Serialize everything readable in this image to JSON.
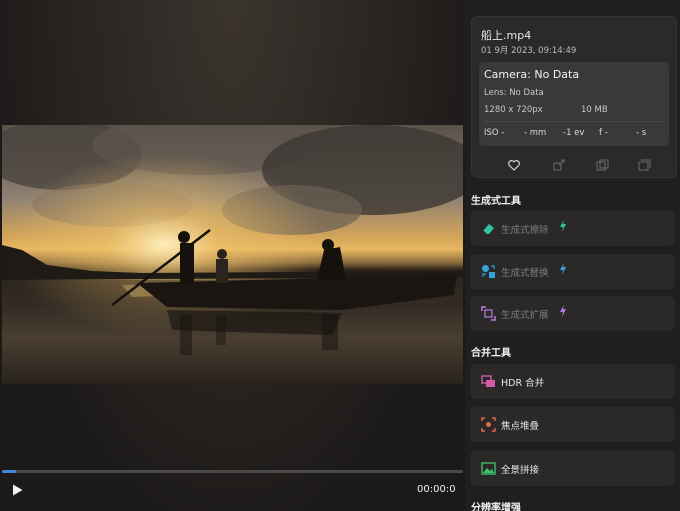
{
  "player": {
    "time": "00:00:0",
    "progress_fraction": 0.03,
    "play_icon": "play-icon"
  },
  "info": {
    "file_name": "船上.mp4",
    "date": "01 9月 2023, 09:14:49",
    "camera": "Camera: No Data",
    "lens": "Lens: No Data",
    "resolution": "1280 x 720px",
    "size": "10 MB",
    "iso": "ISO -",
    "focal": "- mm",
    "ev": "-1 ev",
    "aperture": "f -",
    "shutter": "- s",
    "actions": [
      "heart-icon",
      "share-icon",
      "copy-icon",
      "duplicate-icon"
    ]
  },
  "sections": {
    "generative": {
      "title": "生成式工具",
      "tools": [
        {
          "label": "生成式擦除",
          "icon": "eraser-icon",
          "accent": "#33c3a3"
        },
        {
          "label": "生成式替换",
          "icon": "replace-icon",
          "accent": "#34a3e0"
        },
        {
          "label": "生成式扩展",
          "icon": "expand-icon",
          "accent": "#b77ce0"
        }
      ]
    },
    "merge": {
      "title": "合并工具",
      "tools": [
        {
          "label": "HDR 合并",
          "icon": "hdr-icon",
          "accent": "#d45aa8"
        },
        {
          "label": "焦点堆叠",
          "icon": "focus-stack-icon",
          "accent": "#e06a4a"
        },
        {
          "label": "全景拼接",
          "icon": "panorama-icon",
          "accent": "#3fbf6a"
        }
      ]
    },
    "enhance": {
      "title": "分辨率增强"
    }
  }
}
